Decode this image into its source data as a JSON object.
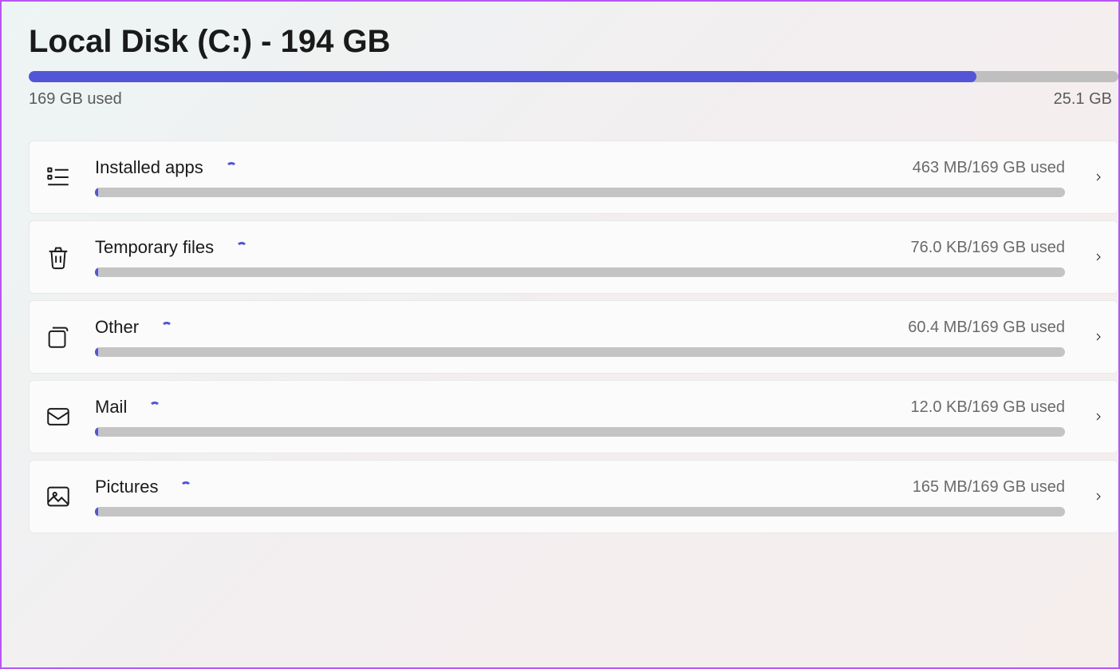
{
  "header": {
    "title": "Local Disk (C:) - 194 GB",
    "used_label": "169 GB used",
    "free_label": "25.1 GB",
    "progress_percent": 87
  },
  "categories": [
    {
      "name": "Installed apps",
      "usage": "463 MB/169 GB used",
      "icon": "apps-list-icon",
      "fill_percent": 0.3
    },
    {
      "name": "Temporary files",
      "usage": "76.0 KB/169 GB used",
      "icon": "trash-icon",
      "fill_percent": 0.1
    },
    {
      "name": "Other",
      "usage": "60.4 MB/169 GB used",
      "icon": "folder-stack-icon",
      "fill_percent": 0.1
    },
    {
      "name": "Mail",
      "usage": "12.0 KB/169 GB used",
      "icon": "mail-icon",
      "fill_percent": 0.1
    },
    {
      "name": "Pictures",
      "usage": "165 MB/169 GB used",
      "icon": "image-icon",
      "fill_percent": 0.2
    }
  ]
}
